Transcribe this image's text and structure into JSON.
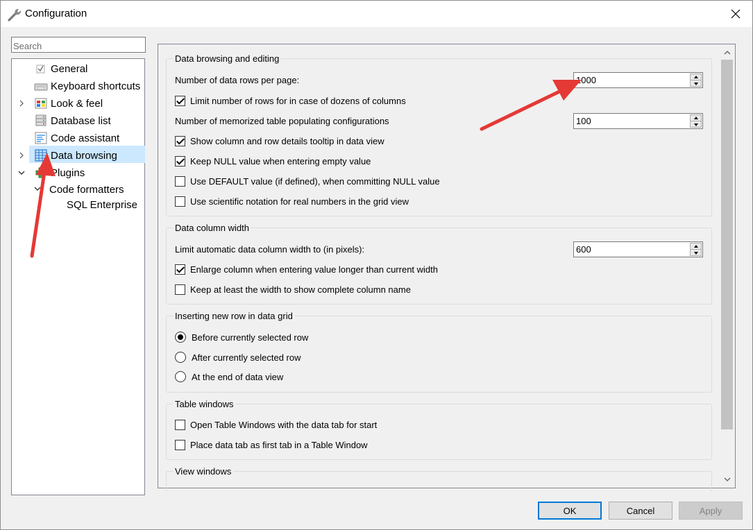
{
  "window": {
    "title": "Configuration"
  },
  "search": {
    "placeholder": "Search"
  },
  "tree": {
    "items": [
      {
        "label": "General"
      },
      {
        "label": "Keyboard shortcuts"
      },
      {
        "label": "Look & feel"
      },
      {
        "label": "Database list"
      },
      {
        "label": "Code assistant"
      },
      {
        "label": "Data browsing"
      },
      {
        "label": "Plugins"
      },
      {
        "label": "Code formatters"
      },
      {
        "label": "SQL Enterprise"
      }
    ]
  },
  "groups": {
    "data_browsing": {
      "title": "Data browsing and editing",
      "rows_per_page_label": "Number of data rows per page:",
      "rows_per_page_value": "1000",
      "limit_rows_label": "Limit number of rows for in case of dozens of columns",
      "limit_rows_checked": true,
      "memorized_label": "Number of memorized table populating configurations",
      "memorized_value": "100",
      "tooltip_label": "Show column and row details tooltip in data view",
      "tooltip_checked": true,
      "keep_null_label": "Keep NULL value when entering empty value",
      "keep_null_checked": true,
      "default_value_label": "Use DEFAULT value (if defined), when committing NULL value",
      "default_value_checked": false,
      "scientific_label": "Use scientific notation for real numbers in the grid view",
      "scientific_checked": false
    },
    "column_width": {
      "title": "Data column width",
      "limit_width_label": "Limit automatic data column width to (in pixels):",
      "limit_width_value": "600",
      "enlarge_label": "Enlarge column when entering value longer than current width",
      "enlarge_checked": true,
      "keep_width_label": "Keep at least the width to show complete column name",
      "keep_width_checked": false
    },
    "inserting": {
      "title": "Inserting new row in data grid",
      "options": [
        {
          "label": "Before currently selected row",
          "selected": true
        },
        {
          "label": "After currently selected row",
          "selected": false
        },
        {
          "label": "At the end of data view",
          "selected": false
        }
      ]
    },
    "table_windows": {
      "title": "Table windows",
      "open_data_tab_label": "Open Table Windows with the data tab for start",
      "open_data_tab_checked": false,
      "place_first_label": "Place data tab as first tab in a Table Window",
      "place_first_checked": false
    },
    "view_windows": {
      "title": "View windows"
    }
  },
  "buttons": {
    "ok": "OK",
    "cancel": "Cancel",
    "apply": "Apply"
  },
  "colors": {
    "selection": "#cce8ff",
    "accent": "#0078d7",
    "arrow": "#e53935"
  }
}
